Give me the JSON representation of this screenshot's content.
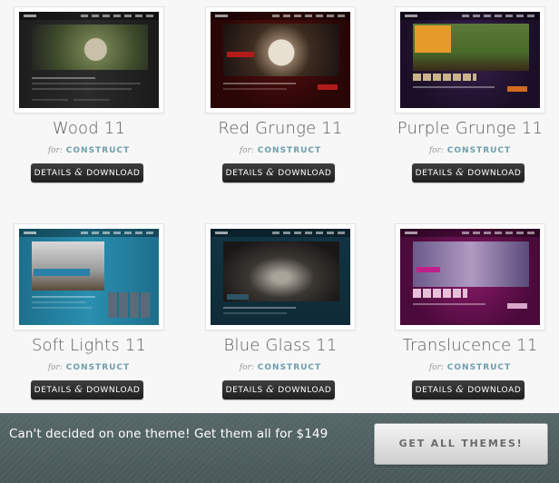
{
  "themes": [
    {
      "name": "Wood 11",
      "for_label": "for:",
      "platform": "CONSTRUCT",
      "button_label": "DETAILS",
      "button_amp": "&",
      "button_label2": "DOWNLOAD"
    },
    {
      "name": "Red Grunge 11",
      "for_label": "for:",
      "platform": "CONSTRUCT",
      "button_label": "DETAILS",
      "button_amp": "&",
      "button_label2": "DOWNLOAD"
    },
    {
      "name": "Purple Grunge 11",
      "for_label": "for:",
      "platform": "CONSTRUCT",
      "button_label": "DETAILS",
      "button_amp": "&",
      "button_label2": "DOWNLOAD"
    },
    {
      "name": "Soft Lights 11",
      "for_label": "for:",
      "platform": "CONSTRUCT",
      "button_label": "DETAILS",
      "button_amp": "&",
      "button_label2": "DOWNLOAD"
    },
    {
      "name": "Blue Glass 11",
      "for_label": "for:",
      "platform": "CONSTRUCT",
      "button_label": "DETAILS",
      "button_amp": "&",
      "button_label2": "DOWNLOAD"
    },
    {
      "name": "Translucence 11",
      "for_label": "for:",
      "platform": "CONSTRUCT",
      "button_label": "DETAILS",
      "button_amp": "&",
      "button_label2": "DOWNLOAD"
    }
  ],
  "footer": {
    "promo_text": "Can't decided on one theme! Get them all for $149",
    "cta_label": "GET ALL THEMES!"
  },
  "colors": {
    "accent_construct": "#6c9eac",
    "button_dark": "#2a2a2a",
    "footer_bg": "#4f6060"
  }
}
